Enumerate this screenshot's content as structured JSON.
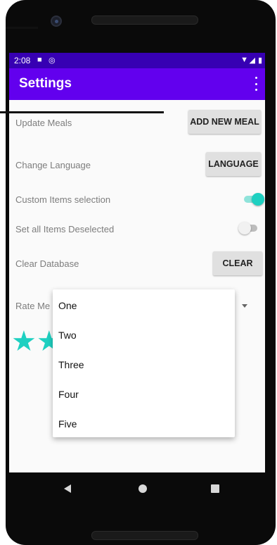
{
  "status_bar": {
    "time": "2:08"
  },
  "app_bar": {
    "title": "Settings"
  },
  "settings": {
    "update_meals": {
      "label": "Update Meals",
      "button": "ADD NEW MEAL"
    },
    "change_language": {
      "label": "Change Language",
      "button": "LANGUAGE"
    },
    "custom_items": {
      "label": "Custom Items selection",
      "on": true
    },
    "deselect_all": {
      "label": "Set all Items Deselected",
      "on": false
    },
    "clear_database": {
      "label": "Clear Database",
      "button": "CLEAR"
    },
    "rate_me": {
      "label": "Rate Me"
    }
  },
  "dropdown": {
    "options": [
      "One",
      "Two",
      "Three",
      "Four",
      "Five"
    ]
  },
  "colors": {
    "accent": "#1ed0c1",
    "primary": "#6200ee",
    "status": "#3700b3"
  }
}
